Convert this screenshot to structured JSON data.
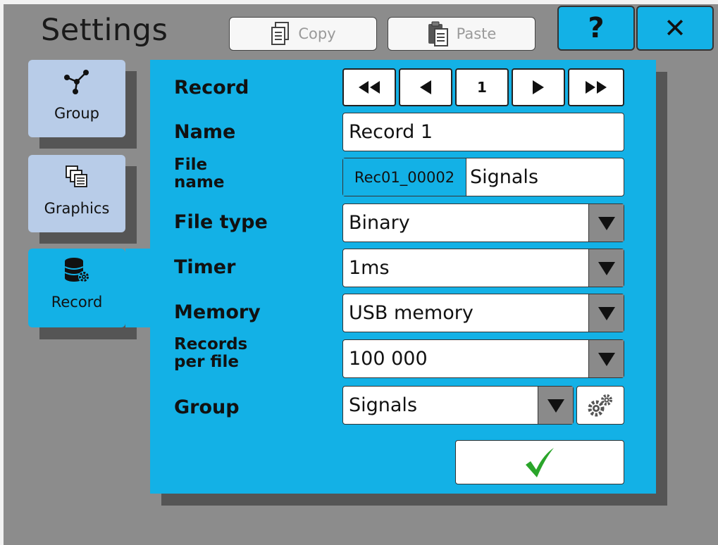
{
  "header": {
    "title": "Settings",
    "copy_label": "Copy",
    "paste_label": "Paste",
    "help_label": "?",
    "close_label": "✕"
  },
  "tabs": [
    {
      "label": "Group",
      "icon": "network-icon",
      "active": false
    },
    {
      "label": "Graphics",
      "icon": "graphics-icon",
      "active": false
    },
    {
      "label": "Record",
      "icon": "database-gear-icon",
      "active": true
    }
  ],
  "form": {
    "record_label": "Record",
    "record_nav": {
      "first": "◀◀",
      "prev": "◀",
      "value": "1",
      "next": "▶",
      "last": "▶▶"
    },
    "name_label": "Name",
    "name_value": "Record 1",
    "file_name_label_line1": "File",
    "file_name_label_line2": "name",
    "file_prefix": "Rec01_00002",
    "file_suffix": "Signals",
    "file_type_label": "File type",
    "file_type_value": "Binary",
    "timer_label": "Timer",
    "timer_value": "1ms",
    "memory_label": "Memory",
    "memory_value": "USB memory",
    "records_per_file_label_line1": "Records",
    "records_per_file_label_line2": "per file",
    "records_per_file_value": "100 000",
    "group_label": "Group",
    "group_value": "Signals"
  },
  "colors": {
    "accent": "#13b1e6",
    "tab_inactive": "#b8cce8",
    "background": "#8c8c8c",
    "check": "#2aa52a"
  }
}
